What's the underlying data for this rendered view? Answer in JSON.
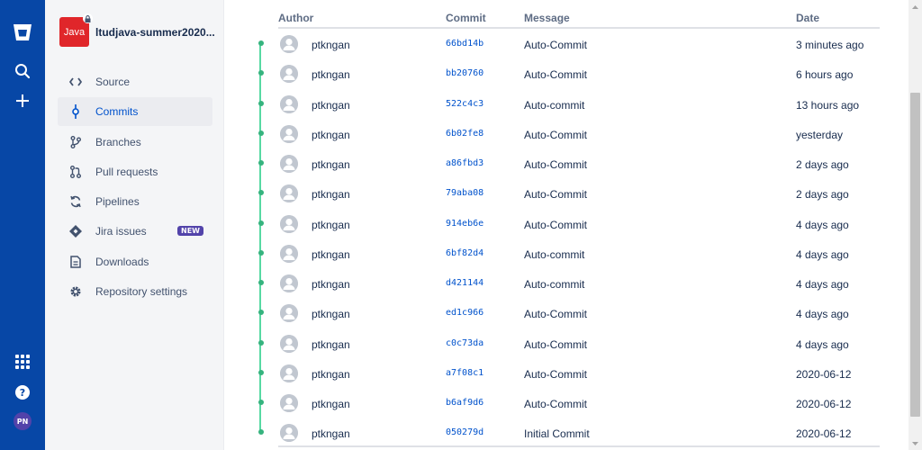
{
  "global_nav": {
    "icons": [
      "bitbucket-logo-icon",
      "search-icon",
      "plus-icon",
      "app-switcher-icon",
      "help-icon"
    ],
    "avatar_initials": "PN",
    "avatar_color": "#5243aa",
    "bg_color": "#0747a6"
  },
  "repo": {
    "avatar_text": "Java",
    "avatar_color": "#e0262a",
    "name": "ltudjava-summer2020..."
  },
  "sidebar": {
    "items": [
      {
        "label": "Source",
        "icon": "code-icon"
      },
      {
        "label": "Commits",
        "icon": "commit-icon",
        "active": true
      },
      {
        "label": "Branches",
        "icon": "branch-icon"
      },
      {
        "label": "Pull requests",
        "icon": "pull-request-icon"
      },
      {
        "label": "Pipelines",
        "icon": "pipelines-icon"
      },
      {
        "label": "Jira issues",
        "icon": "jira-icon",
        "badge": "NEW"
      },
      {
        "label": "Downloads",
        "icon": "download-icon"
      },
      {
        "label": "Repository settings",
        "icon": "gear-icon"
      }
    ]
  },
  "commits": {
    "columns": {
      "author": "Author",
      "commit": "Commit",
      "message": "Message",
      "date": "Date"
    },
    "rows": [
      {
        "author": "ptkngan",
        "hash": "66bd14b",
        "message": "Auto-Commit",
        "date": "3 minutes ago"
      },
      {
        "author": "ptkngan",
        "hash": "bb20760",
        "message": "Auto-Commit",
        "date": "6 hours ago"
      },
      {
        "author": "ptkngan",
        "hash": "522c4c3",
        "message": "Auto-commit",
        "date": "13 hours ago"
      },
      {
        "author": "ptkngan",
        "hash": "6b02fe8",
        "message": "Auto-Commit",
        "date": "yesterday"
      },
      {
        "author": "ptkngan",
        "hash": "a86fbd3",
        "message": "Auto-Commit",
        "date": "2 days ago"
      },
      {
        "author": "ptkngan",
        "hash": "79aba08",
        "message": "Auto-Commit",
        "date": "2 days ago"
      },
      {
        "author": "ptkngan",
        "hash": "914eb6e",
        "message": "Auto-Commit",
        "date": "4 days ago"
      },
      {
        "author": "ptkngan",
        "hash": "6bf82d4",
        "message": "Auto-commit",
        "date": "4 days ago"
      },
      {
        "author": "ptkngan",
        "hash": "d421144",
        "message": "Auto-commit",
        "date": "4 days ago"
      },
      {
        "author": "ptkngan",
        "hash": "ed1c966",
        "message": "Auto-Commit",
        "date": "4 days ago"
      },
      {
        "author": "ptkngan",
        "hash": "c0c73da",
        "message": "Auto-Commit",
        "date": "4 days ago"
      },
      {
        "author": "ptkngan",
        "hash": "a7f08c1",
        "message": "Auto-Commit",
        "date": "2020-06-12"
      },
      {
        "author": "ptkngan",
        "hash": "b6af9d6",
        "message": "Auto-Commit",
        "date": "2020-06-12"
      },
      {
        "author": "ptkngan",
        "hash": "050279d",
        "message": "Initial Commit",
        "date": "2020-06-12"
      }
    ]
  },
  "colors": {
    "accent": "#0052cc",
    "graph": "#36b37e"
  }
}
